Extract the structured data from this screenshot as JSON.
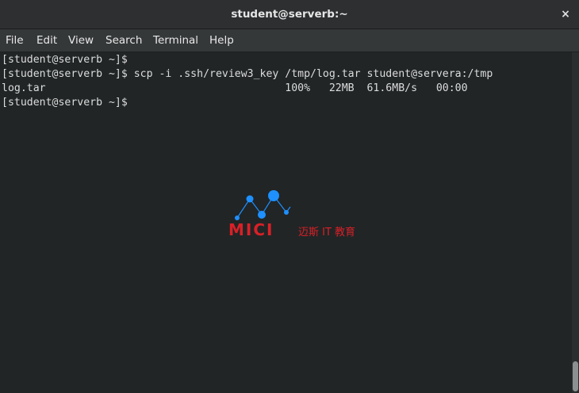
{
  "window": {
    "title": "student@serverb:~",
    "close_label": "×"
  },
  "menu": {
    "items": [
      "File",
      "Edit",
      "View",
      "Search",
      "Terminal",
      "Help"
    ]
  },
  "terminal": {
    "lines": [
      "[student@serverb ~]$",
      "[student@serverb ~]$ scp -i .ssh/review3_key /tmp/log.tar student@servera:/tmp",
      "log.tar                                      100%   22MB  61.6MB/s   00:00",
      "[student@serverb ~]$"
    ]
  },
  "watermark": {
    "brand": "MICI",
    "tagline": "迈斯 IT 教育"
  },
  "colors": {
    "watermark_red": "#d92027",
    "watermark_blue": "#1e90ff"
  }
}
